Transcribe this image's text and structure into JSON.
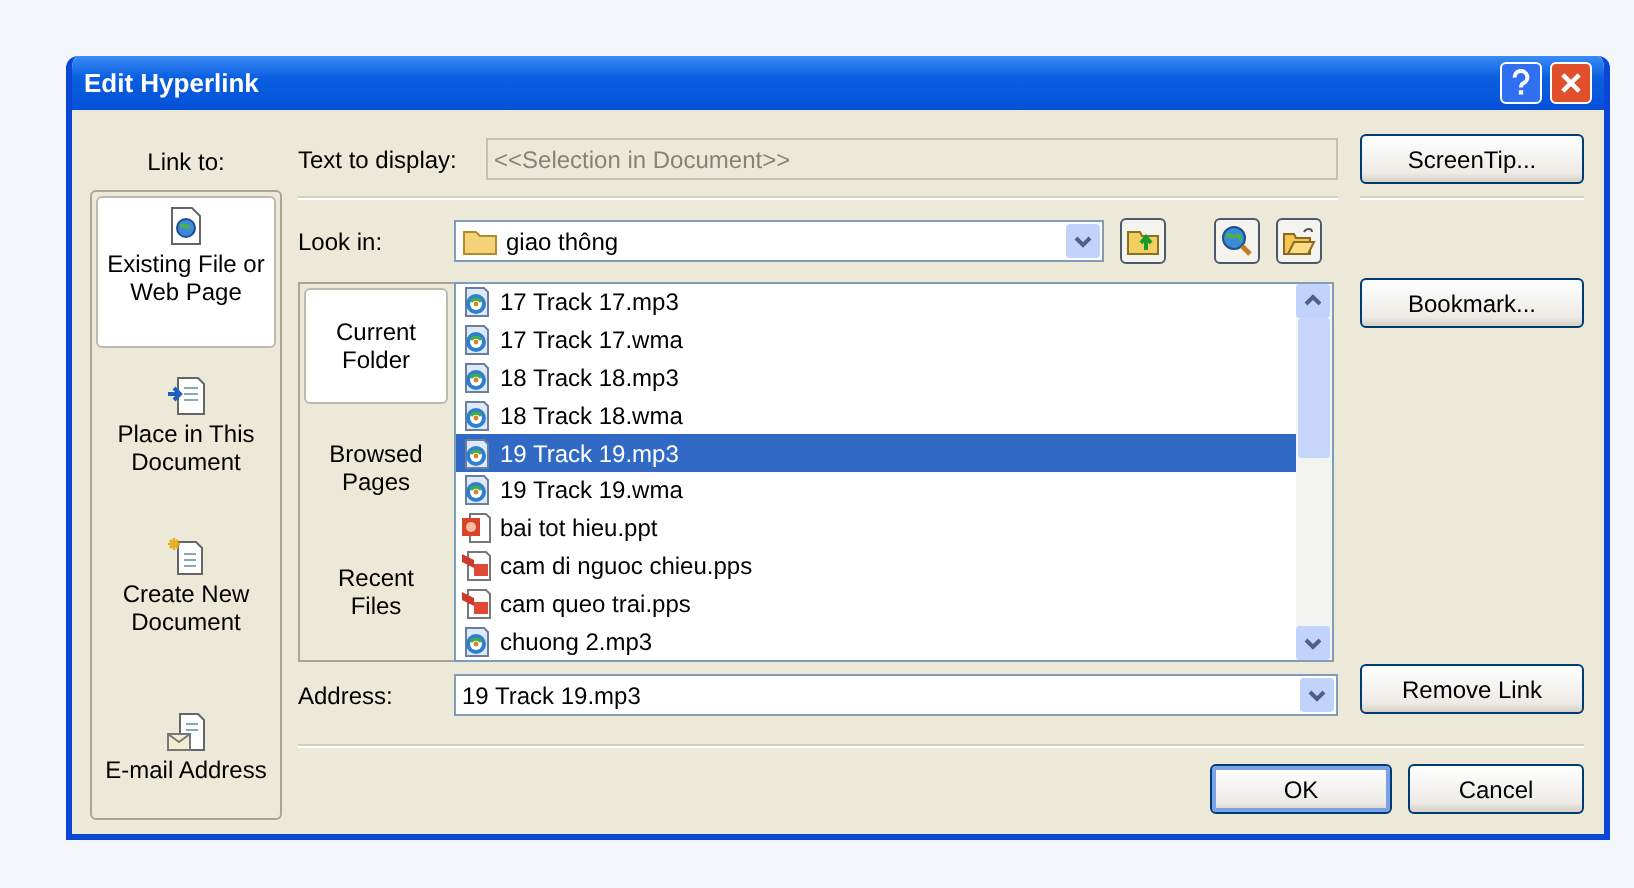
{
  "window": {
    "title": "Edit Hyperlink"
  },
  "link_to": {
    "label": "Link to:",
    "items": [
      {
        "label": "Existing File or Web Page",
        "kind": "file",
        "selected": true
      },
      {
        "label": "Place in This Document",
        "kind": "place",
        "selected": false
      },
      {
        "label": "Create New Document",
        "kind": "new",
        "selected": false
      },
      {
        "label": "E-mail Address",
        "kind": "email",
        "selected": false
      }
    ]
  },
  "text_to_display": {
    "label": "Text to display:",
    "value": "<<Selection in Document>>",
    "disabled": true
  },
  "look_in": {
    "label": "Look in:",
    "value": "giao thông"
  },
  "browse_tabs": [
    {
      "label": "Current Folder",
      "selected": true
    },
    {
      "label": "Browsed Pages",
      "selected": false
    },
    {
      "label": "Recent Files",
      "selected": false
    }
  ],
  "files": [
    {
      "name": "17 Track 17.mp3",
      "kind": "audio",
      "selected": false
    },
    {
      "name": "17 Track 17.wma",
      "kind": "audio",
      "selected": false
    },
    {
      "name": "18 Track 18.mp3",
      "kind": "audio",
      "selected": false
    },
    {
      "name": "18 Track 18.wma",
      "kind": "audio",
      "selected": false
    },
    {
      "name": "19 Track 19.mp3",
      "kind": "audio",
      "selected": true
    },
    {
      "name": "19 Track 19.wma",
      "kind": "audio",
      "selected": false
    },
    {
      "name": "bai tot hieu.ppt",
      "kind": "presentation",
      "selected": false
    },
    {
      "name": "cam di nguoc chieu.pps",
      "kind": "show",
      "selected": false
    },
    {
      "name": "cam queo trai.pps",
      "kind": "show",
      "selected": false
    },
    {
      "name": "chuong 2.mp3",
      "kind": "audio",
      "selected": false
    }
  ],
  "address": {
    "label": "Address:",
    "value": "19 Track 19.mp3"
  },
  "side_buttons": [
    {
      "label": "ScreenTip..."
    },
    {
      "label": "Bookmark..."
    },
    {
      "label": "Remove Link"
    }
  ],
  "footer_buttons": [
    {
      "label": "OK",
      "default": true
    },
    {
      "label": "Cancel",
      "default": false
    }
  ]
}
